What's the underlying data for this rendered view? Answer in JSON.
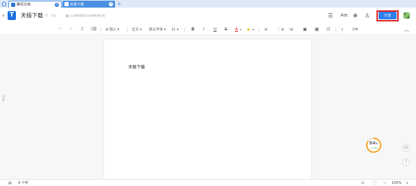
{
  "tabs": [
    {
      "label": "腾讯文档"
    },
    {
      "label": "天极下载"
    }
  ],
  "header": {
    "title": "天极下载",
    "save_status": "上次修改是在1分钟前进行的",
    "share_label": "分享"
  },
  "toolbar": {
    "insert": "插入",
    "style": "正文",
    "font": "默认字体",
    "size": "11",
    "bold": "B",
    "italic": "I",
    "underline": "U",
    "strike": "S",
    "font_color": "A"
  },
  "left_rail": "目录",
  "document": {
    "body_text": "天极下载"
  },
  "widget": {
    "percent": "84",
    "unit": "%",
    "sub": "+ 1.5K/s"
  },
  "statusbar": {
    "word_count": "4 个字",
    "zoom": "100%"
  },
  "colors": {
    "accent": "#2f80ed",
    "highlight_outline": "#e02020",
    "tab_bar": "#dfe9f6",
    "gauge": "#f5a623"
  }
}
